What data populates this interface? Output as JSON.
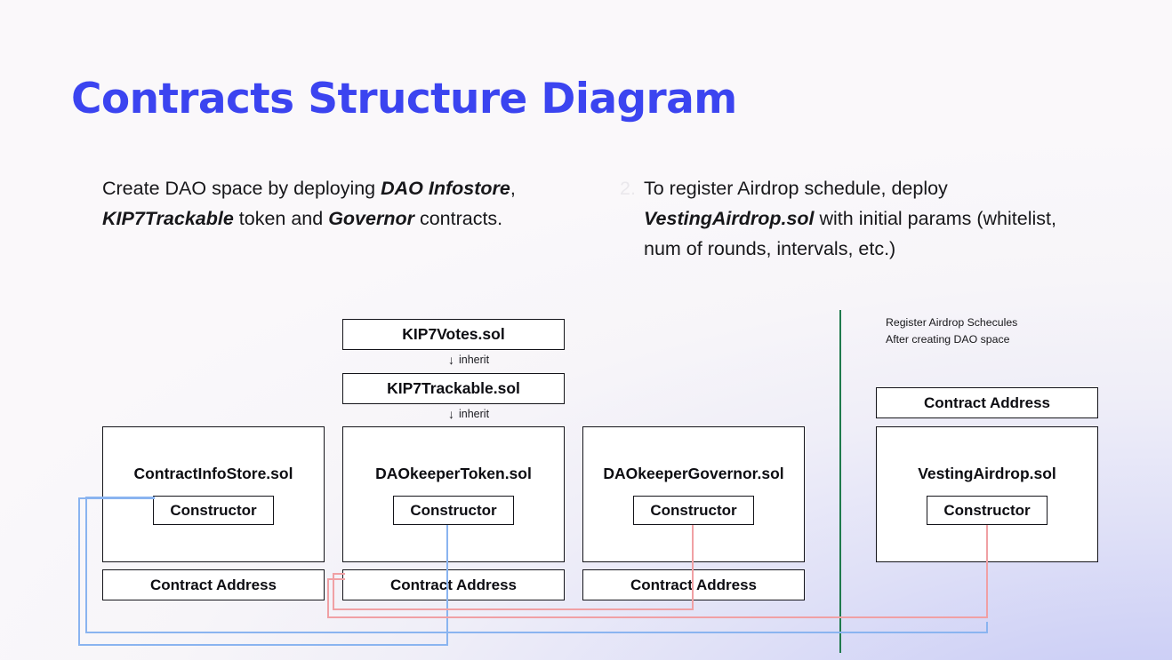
{
  "title": "Contracts Structure Diagram",
  "steps": [
    {
      "number": "",
      "html_text": "Create DAO space by deploying <b>DAO Infostore</b>, <b>KIP7Trackable</b> token and <b>Governor</b> contracts.",
      "plain_text": "Create DAO space by deploying DAO Infostore, KIP7Trackable token and Governor contracts."
    },
    {
      "number": "2.",
      "html_text": "To register Airdrop schedule, deploy <b>VestingAirdrop.sol</b> with initial params (whitelist, num of rounds, intervals, etc.)",
      "plain_text": "To register Airdrop schedule, deploy VestingAirdrop.sol with initial params (whitelist, num of rounds, intervals, etc.)"
    }
  ],
  "note": {
    "line1": "Register Airdrop Schecules",
    "line2": "After creating DAO space"
  },
  "inheritance_chain": {
    "top_box": "KIP7Votes.sol",
    "mid_box": "KIP7Trackable.sol",
    "edge_label_1": "inherit",
    "edge_label_2": "inherit",
    "arrow_glyph": "↓"
  },
  "contracts": [
    {
      "name": "ContractInfoStore.sol",
      "constructor_label": "Constructor",
      "address_label": "Contract Address",
      "has_top_address": false
    },
    {
      "name": "DAOkeeperToken.sol",
      "constructor_label": "Constructor",
      "address_label": "Contract Address",
      "has_top_address": false
    },
    {
      "name": "DAOkeeperGovernor.sol",
      "constructor_label": "Constructor",
      "address_label": "Contract Address",
      "has_top_address": false
    },
    {
      "name": "VestingAirdrop.sol",
      "constructor_label": "Constructor",
      "address_label": "Contract Address",
      "has_top_address": true
    }
  ],
  "colors": {
    "title": "#3b44f0",
    "box_border": "#14141a",
    "box_fill": "#ffffff",
    "connector_blue": "#8ab4f0",
    "connector_red": "#f0a0a4",
    "divider_green": "#1f7a4d",
    "background_top_left": "#f9f7f9",
    "background_bottom_right": "#c6c9f5",
    "step_number_faint": "#eae8ec"
  }
}
